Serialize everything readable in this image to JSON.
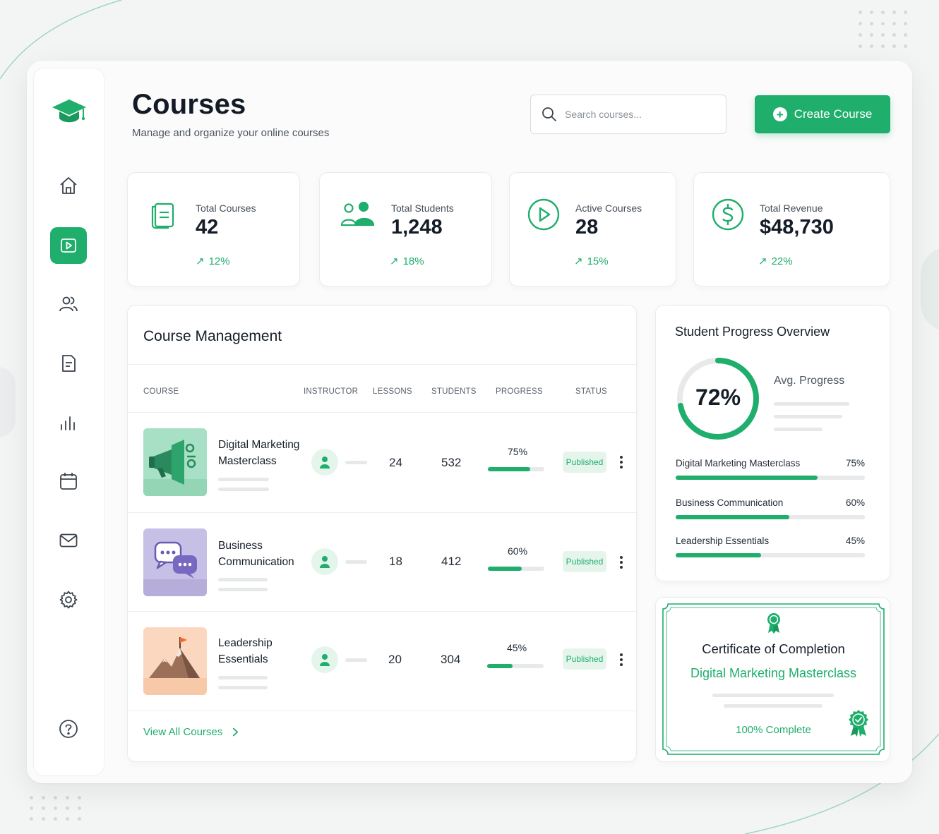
{
  "header": {
    "title": "Courses",
    "subtitle": "Manage and organize your online courses",
    "search_placeholder": "Search courses...",
    "create_label": "Create Course"
  },
  "sidebar": {
    "items": [
      {
        "name": "home",
        "icon": "home-icon",
        "active": false
      },
      {
        "name": "courses",
        "icon": "play-icon",
        "active": true
      },
      {
        "name": "students",
        "icon": "users-icon",
        "active": false
      },
      {
        "name": "documents",
        "icon": "document-icon",
        "active": false
      },
      {
        "name": "analytics",
        "icon": "bar-chart-icon",
        "active": false
      },
      {
        "name": "calendar",
        "icon": "calendar-icon",
        "active": false
      },
      {
        "name": "messages",
        "icon": "mail-icon",
        "active": false
      },
      {
        "name": "settings",
        "icon": "gear-icon",
        "active": false
      },
      {
        "name": "help",
        "icon": "help-icon",
        "active": false
      }
    ]
  },
  "stats": [
    {
      "label": "Total Courses",
      "value": "42",
      "trend": "12%",
      "icon": "book-icon"
    },
    {
      "label": "Total Students",
      "value": "1,248",
      "trend": "18%",
      "icon": "users-icon"
    },
    {
      "label": "Active Courses",
      "value": "28",
      "trend": "15%",
      "icon": "play-circle-icon"
    },
    {
      "label": "Total Revenue",
      "value": "$48,730",
      "trend": "22%",
      "icon": "dollar-icon"
    }
  ],
  "course_management": {
    "title": "Course Management",
    "columns": [
      "COURSE",
      "INSTRUCTOR",
      "LESSONS",
      "STUDENTS",
      "PROGRESS",
      "STATUS"
    ],
    "rows": [
      {
        "name_line1": "Digital Marketing",
        "name_line2": "Masterclass",
        "lessons": "24",
        "students": "532",
        "progress_label": "75%",
        "progress": 0.75,
        "status": "Published",
        "thumb": "megaphone-icon"
      },
      {
        "name_line1": "Business",
        "name_line2": "Communication",
        "lessons": "18",
        "students": "412",
        "progress_label": "60%",
        "progress": 0.6,
        "status": "Published",
        "thumb": "chat-bubbles-icon"
      },
      {
        "name_line1": "Leadership",
        "name_line2": "Essentials",
        "lessons": "20",
        "students": "304",
        "progress_label": "45%",
        "progress": 0.45,
        "status": "Published",
        "thumb": "mountain-flag-icon"
      }
    ],
    "view_all": "View All Courses"
  },
  "student_progress": {
    "title": "Student Progress Overview",
    "avg_value": "72%",
    "avg_fraction": 0.72,
    "avg_label": "Avg. Progress",
    "items": [
      {
        "name": "Digital Marketing Masterclass",
        "pct": "75%",
        "value": 0.75
      },
      {
        "name": "Business Communication",
        "pct": "60%",
        "value": 0.6
      },
      {
        "name": "Leadership Essentials",
        "pct": "45%",
        "value": 0.45
      }
    ]
  },
  "certificate": {
    "title": "Certificate of Completion",
    "course": "Digital Marketing Masterclass",
    "status": "100% Complete"
  },
  "colors": {
    "accent": "#1fae6c",
    "accent_light": "#e6f5ec",
    "text": "#141c27"
  }
}
